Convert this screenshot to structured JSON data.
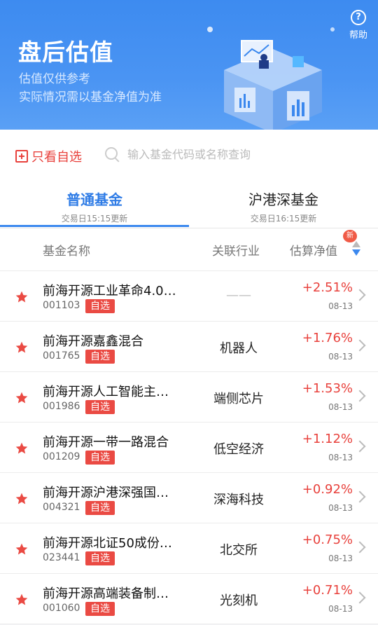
{
  "header": {
    "title": "盘后估值",
    "subtitle1": "估值仅供参考",
    "subtitle2": "实际情况需以基金净值为准",
    "help_label": "帮助",
    "help_glyph": "?"
  },
  "filter": {
    "only_watch_label": "只看自选",
    "search_placeholder": "输入基金代码或名称查询"
  },
  "tabs": [
    {
      "name": "普通基金",
      "time": "交易日15:15更新",
      "active": true
    },
    {
      "name": "沪港深基金",
      "time": "交易日16:15更新",
      "active": false
    }
  ],
  "table": {
    "headers": {
      "name": "基金名称",
      "industry": "关联行业",
      "estimate": "估算净值"
    },
    "new_badge": "新",
    "watch_tag": "自选",
    "rows": [
      {
        "name": "前海开源工业革命4.0…",
        "code": "001103",
        "industry": "——",
        "change": "+2.51%",
        "date": "08-13"
      },
      {
        "name": "前海开源嘉鑫混合",
        "code": "001765",
        "industry": "机器人",
        "change": "+1.76%",
        "date": "08-13"
      },
      {
        "name": "前海开源人工智能主…",
        "code": "001986",
        "industry": "端侧芯片",
        "change": "+1.53%",
        "date": "08-13"
      },
      {
        "name": "前海开源一带一路混合",
        "code": "001209",
        "industry": "低空经济",
        "change": "+1.12%",
        "date": "08-13"
      },
      {
        "name": "前海开源沪港深强国…",
        "code": "004321",
        "industry": "深海科技",
        "change": "+0.92%",
        "date": "08-13"
      },
      {
        "name": "前海开源北证50成份…",
        "code": "023441",
        "industry": "北交所",
        "change": "+0.75%",
        "date": "08-13"
      },
      {
        "name": "前海开源高端装备制…",
        "code": "001060",
        "industry": "光刻机",
        "change": "+0.71%",
        "date": "08-13"
      }
    ]
  },
  "colors": {
    "primary_blue": "#3b88ee",
    "rise_red": "#e8413c",
    "tag_red": "#ea4a43"
  }
}
